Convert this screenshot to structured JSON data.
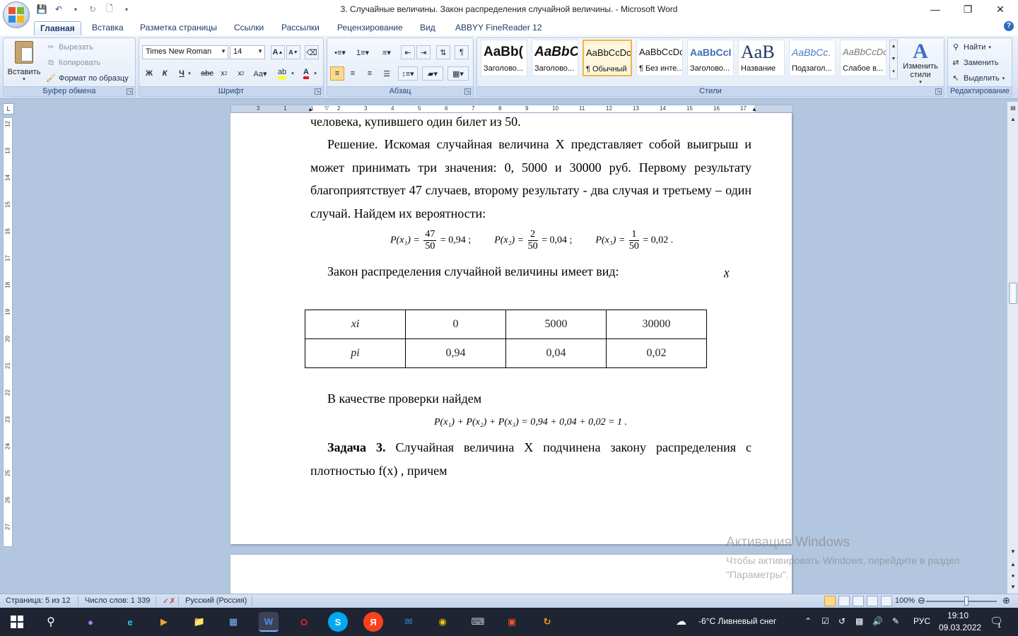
{
  "window": {
    "title": "3. Случайные величины.  Закон распределения случайной величины. - Microsoft Word"
  },
  "ribbon_tabs": [
    "Главная",
    "Вставка",
    "Разметка страницы",
    "Ссылки",
    "Рассылки",
    "Рецензирование",
    "Вид",
    "ABBYY FineReader 12"
  ],
  "clipboard": {
    "paste": "Вставить",
    "cut": "Вырезать",
    "copy": "Копировать",
    "format_painter": "Формат по образцу",
    "label": "Буфер обмена"
  },
  "font_group": {
    "font_name": "Times New Roman",
    "font_size": "14",
    "label": "Шрифт",
    "bold": "Ж",
    "italic": "К",
    "underline": "Ч"
  },
  "paragraph_group": {
    "label": "Абзац"
  },
  "styles": {
    "label": "Стили",
    "items": [
      {
        "sample": "AaBb(",
        "name": "Заголово..."
      },
      {
        "sample": "AaBbC",
        "name": "Заголово..."
      },
      {
        "sample": "AaBbCcDc",
        "name": "¶ Обычный"
      },
      {
        "sample": "AaBbCcDc",
        "name": "¶ Без инте..."
      },
      {
        "sample": "AaBbCcI",
        "name": "Заголово..."
      },
      {
        "sample": "AaB",
        "name": "Название"
      },
      {
        "sample": "AaBbCc.",
        "name": "Подзагол..."
      },
      {
        "sample": "AaBbCcDc",
        "name": "Слабое в..."
      }
    ],
    "change_styles": "Изменить стили"
  },
  "editing": {
    "label": "Редактирование",
    "find": "Найти",
    "replace": "Заменить",
    "select": "Выделить"
  },
  "ruler": {
    "h_ticks": [
      "3",
      "1",
      "1",
      "2",
      "3",
      "4",
      "5",
      "6",
      "7",
      "8",
      "9",
      "10",
      "11",
      "12",
      "13",
      "14",
      "15",
      "16",
      "17"
    ],
    "v_ticks": [
      "12",
      "13",
      "14",
      "15",
      "16",
      "17",
      "18",
      "19",
      "20",
      "21",
      "22",
      "23",
      "24",
      "25",
      "26",
      "27"
    ]
  },
  "document": {
    "line0": "человека, купившего один билет из 50.",
    "para1": "Решение. Искомая случайная величина  X представляет собой выигрыш и может принимать три значения: 0, 5000 и 30000 руб. Первому результату благоприятствует 47 случаев, второму результату - два случая и третьему – один случай. Найдем их вероятности:",
    "prob": [
      {
        "lhs": "P(x₁) =",
        "num": "47",
        "den": "50",
        "rhs": "= 0,94 ;"
      },
      {
        "lhs": "P(x₂) =",
        "num": "2",
        "den": "50",
        "rhs": "= 0,04 ;"
      },
      {
        "lhs": "P(x₃) =",
        "num": "1",
        "den": "50",
        "rhs": "= 0,02 ."
      }
    ],
    "law_text": "Закон распределения случайной величины имеет вид:",
    "stray_x": "x",
    "table": {
      "row1": [
        "xi",
        "0",
        "5000",
        "30000"
      ],
      "row2": [
        "pi",
        "0,94",
        "0,04",
        "0,02"
      ]
    },
    "check_text": "В качестве проверки найдем",
    "check_formula": "P(x₁) + P(x₂) + P(x₃) = 0,94 + 0,04 + 0,02 = 1 .",
    "task_bold": "Задача 3.",
    "task_text": " Случайная величина X подчинена закону распределения с плотностью  f(x) , причем"
  },
  "watermark": {
    "title": "Активация Windows",
    "line1": "Чтобы активировать Windows, перейдите в раздел",
    "line2": "\"Параметры\"."
  },
  "status": {
    "page": "Страница: 5 из 12",
    "words": "Число слов: 1 339",
    "language": "Русский (Россия)",
    "zoom": "100%"
  },
  "taskbar": {
    "weather": "-6°C  Ливневый снег",
    "lang": "РУС",
    "time": "19:10",
    "date": "09.03.2022",
    "notif_count": "1"
  },
  "colors": {
    "ribbon_bg": "#dbe6f5",
    "workspace": "#b3c6e0",
    "taskbar": "#1f2433",
    "selected_style": "#f1b545"
  }
}
